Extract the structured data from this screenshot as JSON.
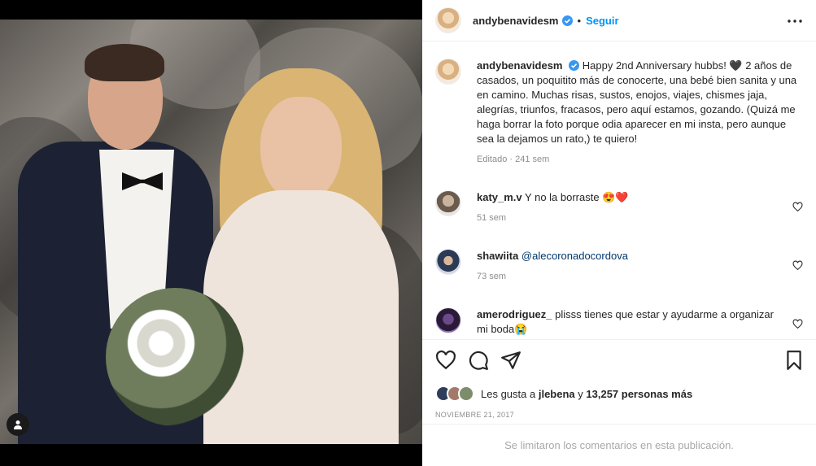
{
  "post": {
    "username": "andybenavidesm",
    "follow_label": "Seguir",
    "separator": "•",
    "more_icon": "more-horizontal-icon"
  },
  "caption": {
    "username": "andybenavidesm",
    "text": "Happy 2nd Anniversary hubbs! 🖤 2 años de casados, un poquitito más de conocerte, una bebé bien sanita y una en camino. Muchas risas, sustos, enojos, viajes, chismes jaja, alegrías, triunfos, fracasos, pero aquí estamos, gozando. (Quizá me haga borrar la foto porque odia aparecer en mi insta, pero aunque sea la dejamos un rato,) te quiero!",
    "meta": "Editado · 241 sem"
  },
  "comments": [
    {
      "username": "katy_m.v",
      "text": "Y no la borraste 😍❤️",
      "meta": "51 sem"
    },
    {
      "username": "shawiita",
      "mention": "@alecoronadocordova",
      "meta": "73 sem"
    },
    {
      "username": "amerodriguez_",
      "text": "plisss tienes que estar y ayudarme a organizar mi boda😭",
      "meta": ""
    }
  ],
  "likes": {
    "prefix": "Les gusta a",
    "user": "jlebena",
    "conj": "y",
    "count": "13,257 personas más"
  },
  "date": "NOVIEMBRE 21, 2017",
  "comments_disabled": "Se limitaron los comentarios en esta publicación.",
  "colors": {
    "accent": "#0095f6",
    "verified": "#3897f0"
  }
}
